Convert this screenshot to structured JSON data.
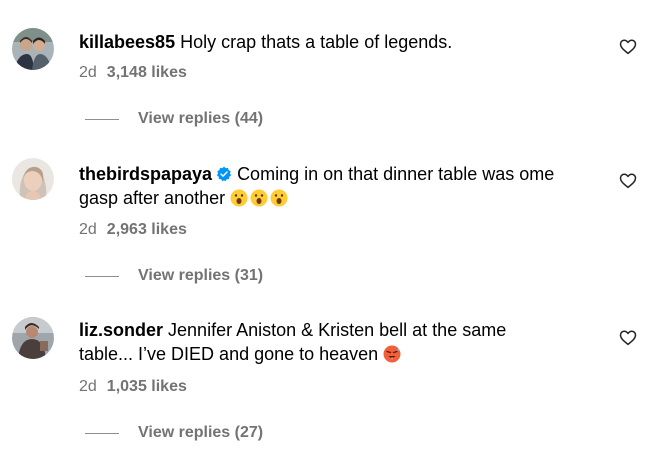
{
  "comments": [
    {
      "username": "killabees85",
      "text": "Holy crap thats a table of legends.",
      "time": "2d",
      "likes": "3,148 likes",
      "replies": "View replies (44)",
      "verified": false
    },
    {
      "username": "thebirdspapaya",
      "text_line1": "Coming in on that dinner table was ome",
      "text_line2": "gasp after another",
      "emoji": "😮😮😮",
      "time": "2d",
      "likes": "2,963 likes",
      "replies": "View replies (31)",
      "verified": true
    },
    {
      "username": "liz.sonder",
      "text_line1": "Jennifer Aniston & Kristen bell at the same",
      "text_line2": "table... I’ve DIED and gone to heaven",
      "emoji": "🥵",
      "time": "2d",
      "likes": "1,035 likes",
      "replies": "View replies (27)",
      "verified": false
    }
  ],
  "icons": {
    "like": "heart-outline-icon",
    "verified": "verified-badge-icon"
  },
  "colors": {
    "text": "#000000",
    "secondary": "#737373",
    "verified": "#0095f6"
  }
}
